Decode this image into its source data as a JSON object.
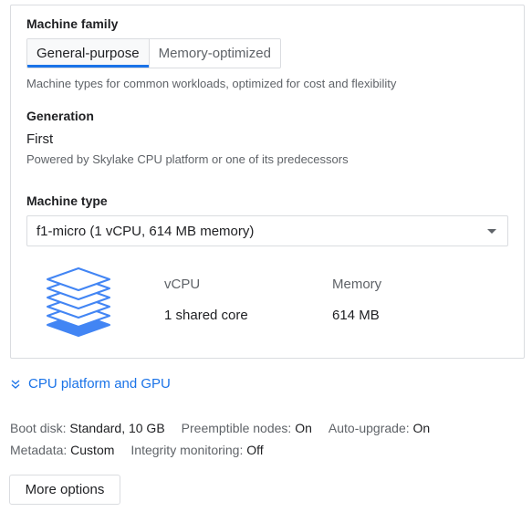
{
  "machine_family": {
    "label": "Machine family",
    "tabs": [
      {
        "label": "General-purpose",
        "selected": true
      },
      {
        "label": "Memory-optimized",
        "selected": false
      }
    ],
    "helper": "Machine types for common workloads, optimized for cost and flexibility"
  },
  "generation": {
    "label": "Generation",
    "value": "First",
    "helper": "Powered by Skylake CPU platform or one of its predecessors"
  },
  "machine_type": {
    "label": "Machine type",
    "selected": "f1-micro (1 vCPU, 614 MB memory)",
    "specs": {
      "vcpu_header": "vCPU",
      "vcpu_value": "1 shared core",
      "memory_header": "Memory",
      "memory_value": "614 MB"
    }
  },
  "cpu_platform_link": "CPU platform and GPU",
  "summary": {
    "boot_disk_key": "Boot disk:",
    "boot_disk_val": "Standard, 10 GB",
    "preemptible_key": "Preemptible nodes:",
    "preemptible_val": "On",
    "auto_upgrade_key": "Auto-upgrade:",
    "auto_upgrade_val": "On",
    "metadata_key": "Metadata:",
    "metadata_val": "Custom",
    "integrity_key": "Integrity monitoring:",
    "integrity_val": "Off"
  },
  "more_options_label": "More options",
  "icons": {
    "stack": "layers-stack-icon",
    "expand": "double-chevron-down-icon",
    "dropdown": "caret-down-icon"
  },
  "colors": {
    "accent": "#1a73e8",
    "stack_fill": "#4285f4"
  }
}
